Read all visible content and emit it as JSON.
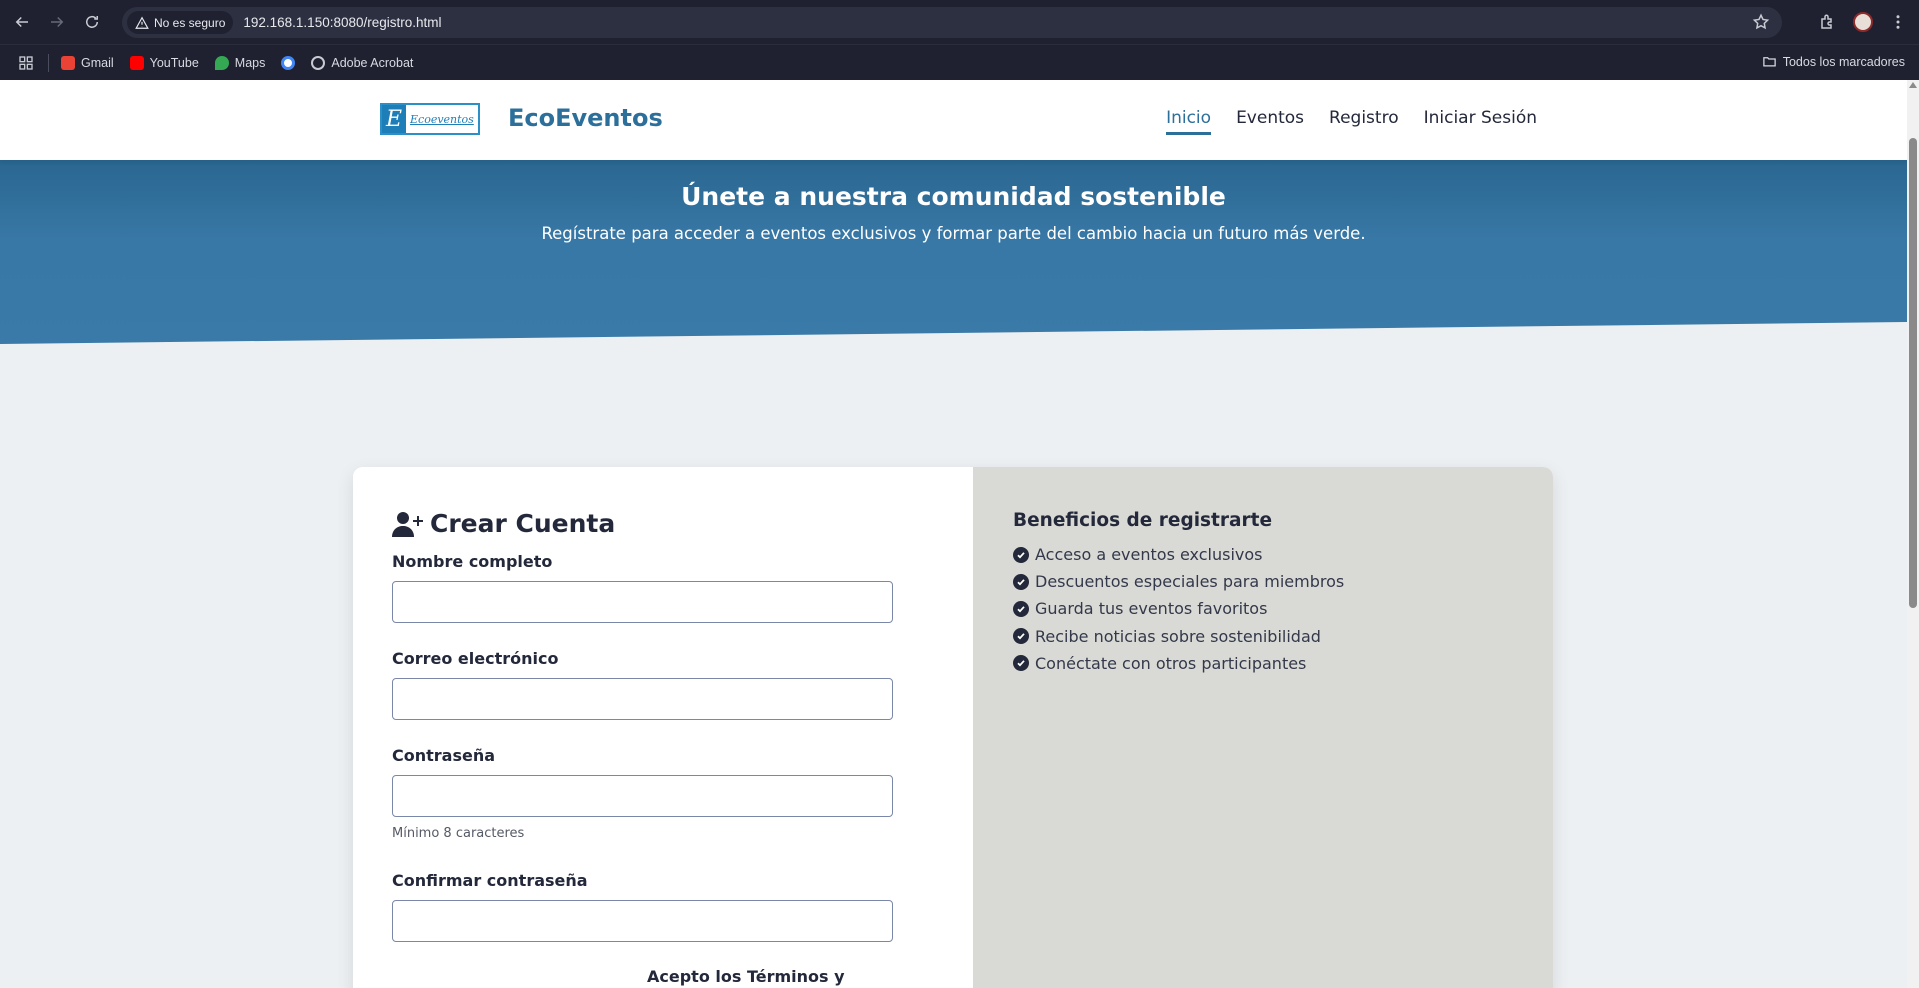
{
  "browser": {
    "security_label": "No es seguro",
    "url": "192.168.1.150:8080/registro.html",
    "bookmarks": [
      {
        "label": "Gmail",
        "icon": "gmail-icon",
        "color": "#ea4335"
      },
      {
        "label": "YouTube",
        "icon": "youtube-icon",
        "color": "#ff0000"
      },
      {
        "label": "Maps",
        "icon": "maps-icon",
        "color": "#34a853"
      },
      {
        "label": "",
        "icon": "google-icon",
        "color": "#4285f4"
      },
      {
        "label": "Adobe Acrobat",
        "icon": "globe-icon",
        "color": "#c9cbd3"
      }
    ],
    "all_bookmarks_label": "Todos los marcadores"
  },
  "site": {
    "logo_text": "Ecoeventos",
    "brand": "EcoEventos",
    "nav": [
      "Inicio",
      "Eventos",
      "Registro",
      "Iniciar Sesión"
    ],
    "active_nav": "Inicio",
    "accent_color": "#2b6f9a"
  },
  "hero": {
    "title": "Únete a nuestra comunidad sostenible",
    "subtitle": "Regístrate para acceder a eventos exclusivos y formar parte del cambio hacia un futuro más verde."
  },
  "form": {
    "title": "Crear Cuenta",
    "fields": [
      {
        "label": "Nombre completo",
        "value": ""
      },
      {
        "label": "Correo electrónico",
        "value": ""
      },
      {
        "label": "Contraseña",
        "value": "",
        "help": "Mínimo 8 caracteres"
      },
      {
        "label": "Confirmar contraseña",
        "value": ""
      }
    ],
    "terms_label": "Acepto los Términos y"
  },
  "benefits": {
    "title": "Beneficios de registrarte",
    "items": [
      "Acceso a eventos exclusivos",
      "Descuentos especiales para miembros",
      "Guarda tus eventos favoritos",
      "Recibe noticias sobre sostenibilidad",
      "Conéctate con otros participantes"
    ]
  }
}
